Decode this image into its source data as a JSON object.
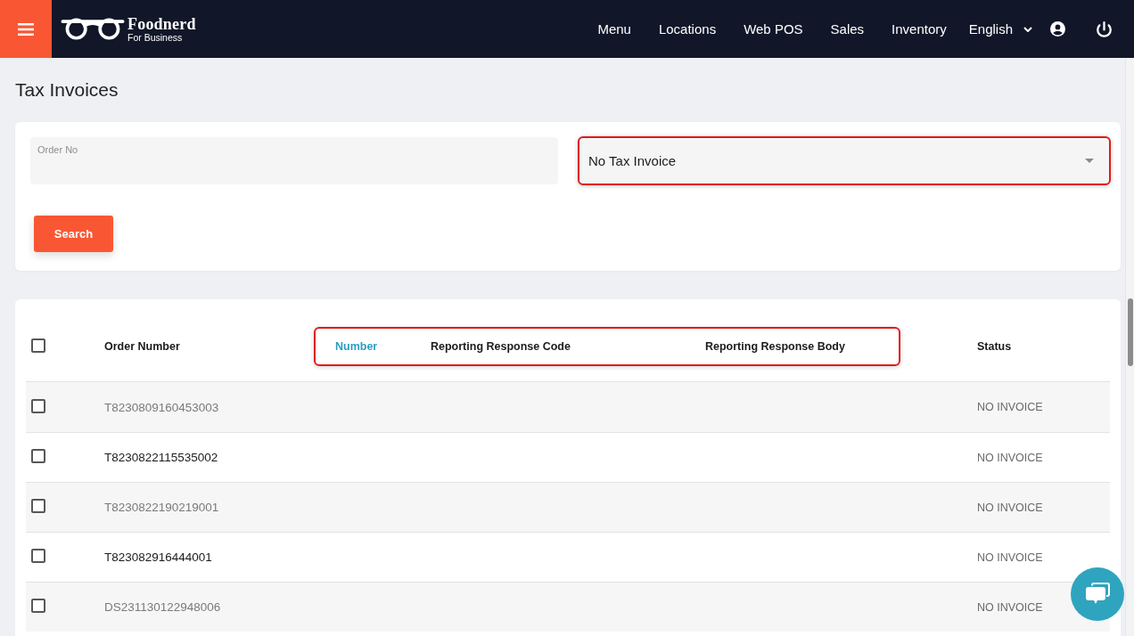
{
  "top_bar": {
    "brand": {
      "name": "Foodnerd",
      "tagline": "For Business"
    },
    "nav": [
      {
        "label": "Menu"
      },
      {
        "label": "Locations"
      },
      {
        "label": "Web POS"
      },
      {
        "label": "Sales"
      },
      {
        "label": "Inventory"
      }
    ],
    "language": "English"
  },
  "page_title": "Tax Invoices",
  "filters": {
    "order_no": {
      "label": "Order No"
    },
    "invoice_filter": {
      "value": "No Tax Invoice",
      "highlighted": true
    },
    "search_button": "Search"
  },
  "table": {
    "select_all": {
      "checked": false
    },
    "columns": [
      {
        "label": "Order Number",
        "highlighted": false,
        "sorted": false
      },
      {
        "label": "Number",
        "highlighted": true,
        "sorted": true
      },
      {
        "label": "Reporting Response Code",
        "highlighted": true,
        "sorted": false
      },
      {
        "label": "Reporting Response Body",
        "highlighted": true,
        "sorted": false
      },
      {
        "label": "Status",
        "highlighted": false,
        "sorted": false
      }
    ],
    "rows": [
      {
        "checked": false,
        "order_number": "T8230809160453003",
        "status": "NO INVOICE"
      },
      {
        "checked": false,
        "order_number": "T8230822115535002",
        "status": "NO INVOICE"
      },
      {
        "checked": false,
        "order_number": "T8230822190219001",
        "status": "NO INVOICE"
      },
      {
        "checked": false,
        "order_number": "T823082916444001",
        "status": "NO INVOICE"
      },
      {
        "checked": false,
        "order_number": "DS231130122948006",
        "status": "NO INVOICE"
      }
    ]
  }
}
